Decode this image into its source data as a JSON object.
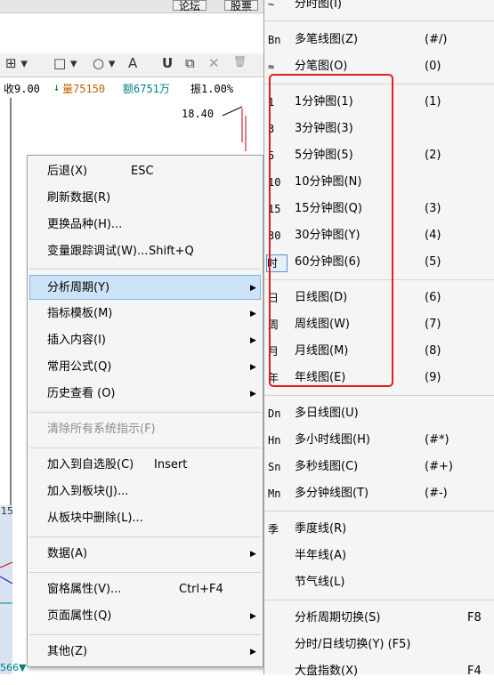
{
  "background": {
    "top_buttons": [
      "论坛",
      "股票"
    ],
    "toolbar_icons": [
      "grid-icon",
      "rectangle-icon",
      "circle-icon",
      "text-icon",
      "magnet-icon",
      "copy-icon",
      "delete-icon",
      "trash-icon"
    ],
    "toolbar_glyphs": {
      "grid": "⊞ ▾",
      "rect": "□ ▾",
      "circle": "○ ▾",
      "text": "A",
      "magnet": "U",
      "copy": "⧉",
      "delete": "✕",
      "trash": "🗑"
    },
    "quote": {
      "close": "收9.00",
      "volume_label": "量75150",
      "amount_label": "额6751万",
      "amplitude": "振1.00%",
      "arrow": "↓"
    },
    "price_label": "18.40",
    "side_label": "15",
    "bottom_label": "566▼",
    "colors": {
      "red": "#c00000",
      "green": "#008000",
      "blue": "#0000c0",
      "highlight": "#e02020"
    }
  },
  "context_menu": {
    "items": [
      {
        "label": "后退(X)",
        "shortcut": "ESC"
      },
      {
        "label": "刷新数据(R)"
      },
      {
        "label": "更换品种(H)..."
      },
      {
        "label": "变量跟踪调试(W)...",
        "shortcut": "Shift+Q"
      },
      {
        "label": "分析周期(Y)",
        "submenu": true,
        "active": true
      },
      {
        "label": "指标模板(M)",
        "submenu": true
      },
      {
        "label": "插入内容(I)",
        "submenu": true
      },
      {
        "label": "常用公式(Q)",
        "submenu": true
      },
      {
        "label": "历史查看 (O)",
        "submenu": true
      },
      {
        "label": "清除所有系统指示(F)",
        "disabled": true
      },
      {
        "label": "加入到自选股(C)",
        "shortcut": "Insert"
      },
      {
        "label": "加入到板块(J)..."
      },
      {
        "label": "从板块中删除(L)..."
      },
      {
        "label": "数据(A)",
        "submenu": true
      },
      {
        "label": "窗格属性(V)...",
        "shortcut": "Ctrl+F4"
      },
      {
        "label": "页面属性(Q)",
        "submenu": true
      },
      {
        "label": "其他(Z)",
        "submenu": true
      }
    ]
  },
  "sub_menu": {
    "items": [
      {
        "icon": "~",
        "label": "分时图(I)",
        "shortcut": ""
      },
      {
        "icon": "Bn",
        "label": "多笔线图(Z)",
        "shortcut": "(#/)"
      },
      {
        "icon": "≈",
        "label": "分笔图(O)",
        "shortcut": "(0)"
      },
      {
        "icon": "1",
        "label": "1分钟图(1)",
        "shortcut": "(1)"
      },
      {
        "icon": "3",
        "label": "3分钟图(3)",
        "shortcut": ""
      },
      {
        "icon": "5",
        "label": "5分钟图(5)",
        "shortcut": "(2)"
      },
      {
        "icon": "10",
        "label": "10分钟图(N)",
        "shortcut": ""
      },
      {
        "icon": "15",
        "label": "15分钟图(Q)",
        "shortcut": "(3)"
      },
      {
        "icon": "30",
        "label": "30分钟图(Y)",
        "shortcut": "(4)"
      },
      {
        "icon": "时",
        "label": "60分钟图(6)",
        "shortcut": "(5)"
      },
      {
        "icon": "日",
        "label": "日线图(D)",
        "shortcut": "(6)"
      },
      {
        "icon": "周",
        "label": "周线图(W)",
        "shortcut": "(7)"
      },
      {
        "icon": "月",
        "label": "月线图(M)",
        "shortcut": "(8)"
      },
      {
        "icon": "年",
        "label": "年线图(E)",
        "shortcut": "(9)"
      },
      {
        "icon": "Dn",
        "label": "多日线图(U)",
        "shortcut": ""
      },
      {
        "icon": "Hn",
        "label": "多小时线图(H)",
        "shortcut": "(#*)"
      },
      {
        "icon": "Sn",
        "label": "多秒线图(C)",
        "shortcut": "(#+)"
      },
      {
        "icon": "Mn",
        "label": "多分钟线图(T)",
        "shortcut": "(#-)"
      },
      {
        "icon": "季",
        "label": "季度线(R)",
        "shortcut": ""
      },
      {
        "icon": "",
        "label": "半年线(A)",
        "shortcut": ""
      },
      {
        "icon": "",
        "label": "节气线(L)",
        "shortcut": ""
      },
      {
        "icon": "",
        "label": "分析周期切换(S)",
        "shortcut": "F8"
      },
      {
        "icon": "",
        "label": "分时/日线切换(Y) (F5)",
        "shortcut": ""
      },
      {
        "icon": "",
        "label": "大盘指数(X)",
        "shortcut": "F4"
      }
    ]
  }
}
